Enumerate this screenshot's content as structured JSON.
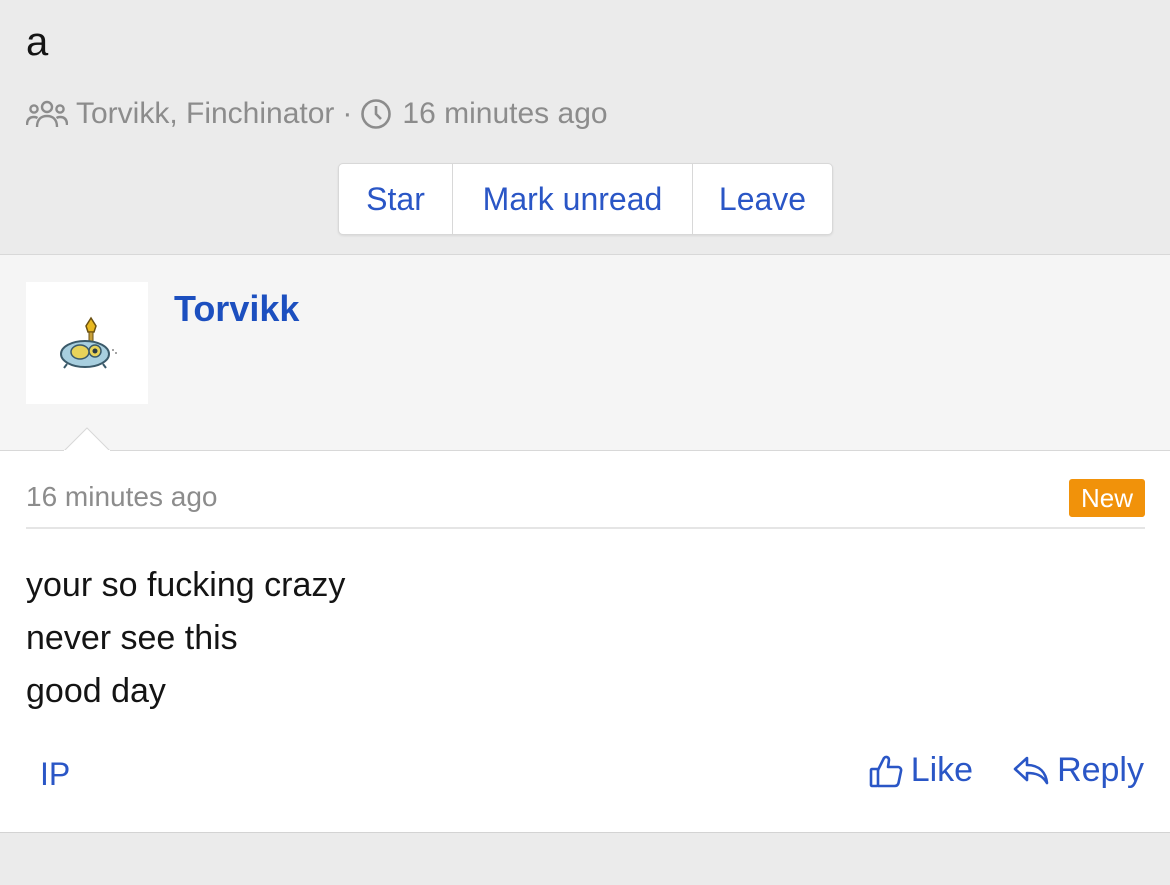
{
  "conversation": {
    "title": "a",
    "participants": "Torvikk, Finchinator",
    "separator": "·",
    "time": "16 minutes ago"
  },
  "buttons": {
    "star": "Star",
    "mark_unread": "Mark unread",
    "leave": "Leave"
  },
  "message": {
    "author": "Torvikk",
    "time": "16 minutes ago",
    "badge": "New",
    "lines": [
      "your so fucking crazy",
      "never see this",
      "good day"
    ],
    "ip_label": "IP",
    "like_label": "Like",
    "reply_label": "Reply"
  },
  "icons": {
    "participants": "users-icon",
    "clock": "clock-icon",
    "like": "thumbs-up-icon",
    "reply": "reply-icon"
  },
  "colors": {
    "link": "#2a56c6",
    "author": "#1c4fbf",
    "badge": "#f1920a",
    "muted": "#8c8c8c"
  }
}
